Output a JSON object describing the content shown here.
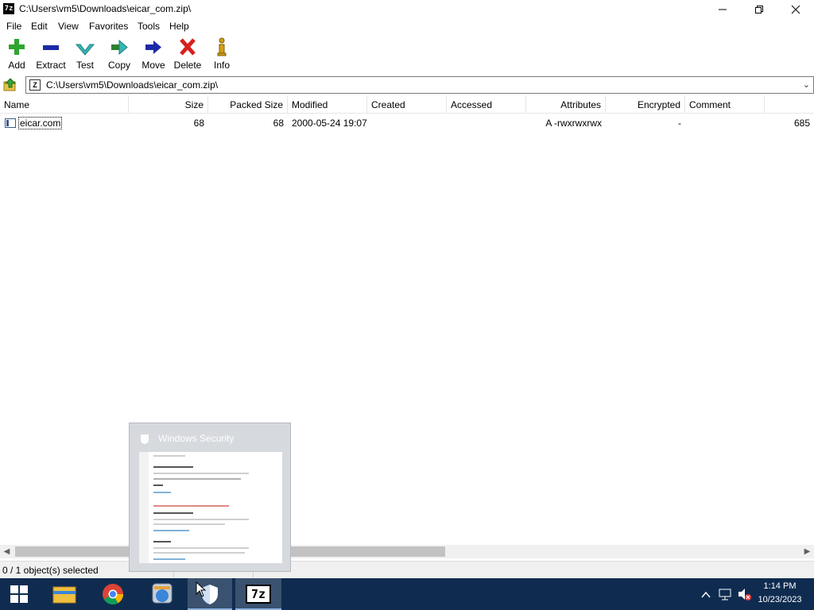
{
  "window": {
    "title": "C:\\Users\\vm5\\Downloads\\eicar_com.zip\\",
    "app_icon": "7z",
    "minimize_icon": "minimize-icon",
    "maximize_icon": "restore-icon",
    "close_icon": "close-icon"
  },
  "menu": [
    "File",
    "Edit",
    "View",
    "Favorites",
    "Tools",
    "Help"
  ],
  "toolbar": {
    "add": "Add",
    "extract": "Extract",
    "test": "Test",
    "copy": "Copy",
    "move": "Move",
    "delete": "Delete",
    "info": "Info"
  },
  "address": {
    "path": "C:\\Users\\vm5\\Downloads\\eicar_com.zip\\"
  },
  "columns": [
    "Name",
    "Size",
    "Packed Size",
    "Modified",
    "Created",
    "Accessed",
    "Attributes",
    "Encrypted",
    "Comment"
  ],
  "files": [
    {
      "name": "eicar.com",
      "size": "68",
      "packed_size": "68",
      "modified": "2000-05-24 19:07",
      "created": "",
      "accessed": "",
      "attributes": "A -rwxrwxrwx",
      "encrypted": "-",
      "comment": "",
      "extra": "685"
    }
  ],
  "status": {
    "selection": "0 / 1 object(s) selected"
  },
  "thumbnail": {
    "title": "Windows Security"
  },
  "taskbar": {
    "time": "1:14 PM",
    "date": "10/23/2023",
    "seven_zip_label": "7z"
  },
  "colors": {
    "taskbar": "#0f2c50",
    "add_icon": "#2fa52f",
    "extract_icon": "#1a2aa8",
    "test_icon": "#35b7b7",
    "delete_icon": "#d61f1f",
    "info_icon": "#d4a017"
  }
}
